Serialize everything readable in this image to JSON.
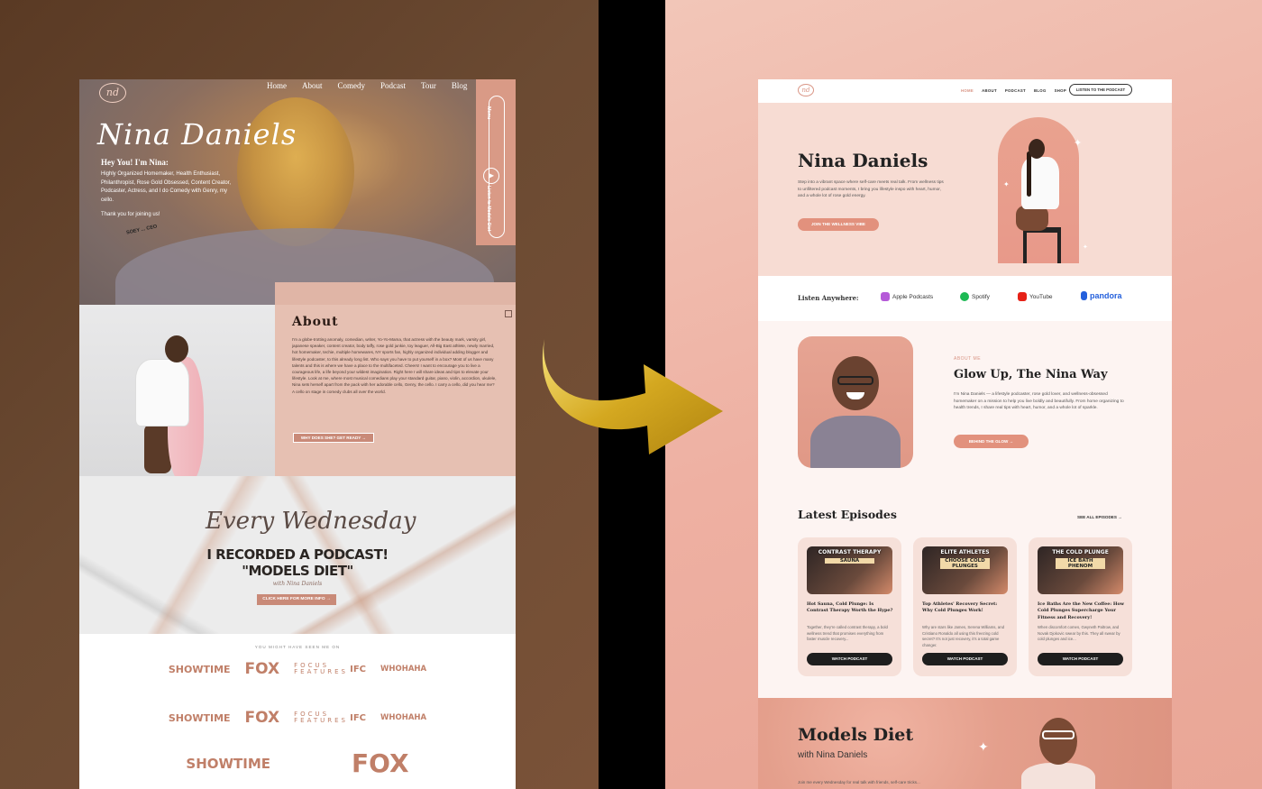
{
  "colors": {
    "old_accent": "#c98a78",
    "new_accent": "#e2917d",
    "left_bg": "#6b4a32",
    "right_bg": "#eeb0a2"
  },
  "old_site": {
    "logo": "nd",
    "nav": [
      "Home",
      "About",
      "Comedy",
      "Podcast",
      "Tour",
      "Blog"
    ],
    "script_name": "Nina Daniels",
    "hey": "Hey You! I'm Nina:",
    "intro": "Highly Organized Homemaker, Health Enthusiast, Philanthropist, Rose Gold Obsessed, Content Creator, Podcaster, Actress, and I do Comedy with Genry, my cello.",
    "thanks": "Thank you for joining us!",
    "stamp": "SOEY ... CEO",
    "side_tab_top": "Menu",
    "side_tab_bottom": "Listen to Models Diet",
    "about_title": "About",
    "about_text": "I'm a globe-trotting anomaly, comedian, writer, Yo-Yo-Mama, that actress with the beauty mark, varsity girl, japanese speaker, content creator, body taffy, rose gold junkie, toy leaguer, All-Big East athlete, newly married, hot homemaker, techie, multiple homewares, NY sports fan, highly organized individual adding blogger and lifestyle podcaster, to this already long list. Who says you have to put yourself in a box? Most of us have many talents and this is where we have a place to the multifaceted. Cheers! I want to encourage you to live a courageous life, a life beyond your wildest imagination. Right here I will share ideas and tips to elevate your lifestyle. Look at me, where most musical comedians play your standard guitar, piano, violin, accordion, ukulele, Nina sets herself apart from the pack with her adorable cello, Genry, the cello. I carry a cello, did you hear me? A cello on stage in comedy clubs all over the world.",
    "about_button": "WHY DOES SHE? GET READY →",
    "every": "Every Wednesday",
    "podcast_line1": "I RECORDED A PODCAST!",
    "podcast_line2": "\"MODELS DIET\"",
    "with": "with Nina Daniels",
    "listen_button": "CLICK HERE FOR MORE INFO →",
    "seen_on": "YOU MIGHT HAVE SEEN ME ON",
    "logo_rows": [
      [
        "SHOWTIME",
        "FOX",
        "FOCUS FEATURES",
        "IFC",
        "WHOHAHA"
      ],
      [
        "SHOWTIME",
        "FOX",
        "FOCUS FEATURES",
        "IFC",
        "WHOHAHA"
      ],
      [
        "SHOWTIME",
        "FOX"
      ]
    ]
  },
  "new_site": {
    "logo": "nd",
    "nav": [
      "HOME",
      "ABOUT",
      "PODCAST",
      "BLOG",
      "SHOP"
    ],
    "nav_cta": "LISTEN TO THE PODCAST",
    "hero_title": "Nina Daniels",
    "hero_sub": "Step into a vibrant space where self-care meets real talk. From wellness tips to unfiltered podcast moments, I bring you lifestyle inspo with heart, humor, and a whole lot of rose gold energy.",
    "hero_button": "JOIN THE WELLNESS VIBE",
    "listen_label": "Listen Anywhere:",
    "platforms": [
      {
        "name": "Apple Podcasts",
        "color": "#b55ad8"
      },
      {
        "name": "Spotify",
        "color": "#1db954"
      },
      {
        "name": "YouTube",
        "color": "#e62117"
      },
      {
        "name": "pandora",
        "color": "#2460dc"
      }
    ],
    "about_kicker": "ABOUT ME",
    "about_title": "Glow Up, The Nina Way",
    "about_text": "I'm Nina Daniels — a lifestyle podcaster, rose gold lover, and wellness-obsessed homemaker on a mission to help you live boldly and beautifully. From home organizing to health trends, I share real tips with heart, humor, and a whole lot of sparkle.",
    "about_button": "BEHIND THE GLOW →",
    "episodes_title": "Latest Episodes",
    "see_all": "SEE ALL EPISODES →",
    "episodes": [
      {
        "thumb_top": "CONTRAST THERAPY",
        "thumb_tag": "SAUNA",
        "title": "Hot Sauna, Cold Plunge: Is Contrast Therapy Worth the Hype?",
        "desc": "Together, they're called contrast therapy, a bold wellness trend that promises everything from faster muscle recovery...",
        "button": "WATCH PODCAST"
      },
      {
        "thumb_top": "ELITE ATHLETES",
        "thumb_tag": "CHOOSE COLD PLUNGES",
        "title": "Top Athletes' Recovery Secret: Why Cold Plunges Work!",
        "desc": "Why are stars like James, Serena Williams, and Cristiano Ronaldo all using this freezing cold secret? It's not just recovery, it's a total game changer.",
        "button": "WATCH PODCAST"
      },
      {
        "thumb_top": "THE COLD PLUNGE",
        "thumb_tag": "ICE BATH PHENOM",
        "title": "Ice Baths Are the New Coffee: How Cold Plunges Supercharge Your Fitness and Recovery!",
        "desc": "When discomfort comes, Gwyneth Paltrow, and Novak Djokovic swear by this. They all swear by cold plunges and ice...",
        "button": "WATCH PODCAST"
      }
    ],
    "diet_title": "Models Diet",
    "diet_sub": "with Nina Daniels",
    "diet_more": "Join me every Wednesday for real talk with friends, self-care tricks..."
  }
}
